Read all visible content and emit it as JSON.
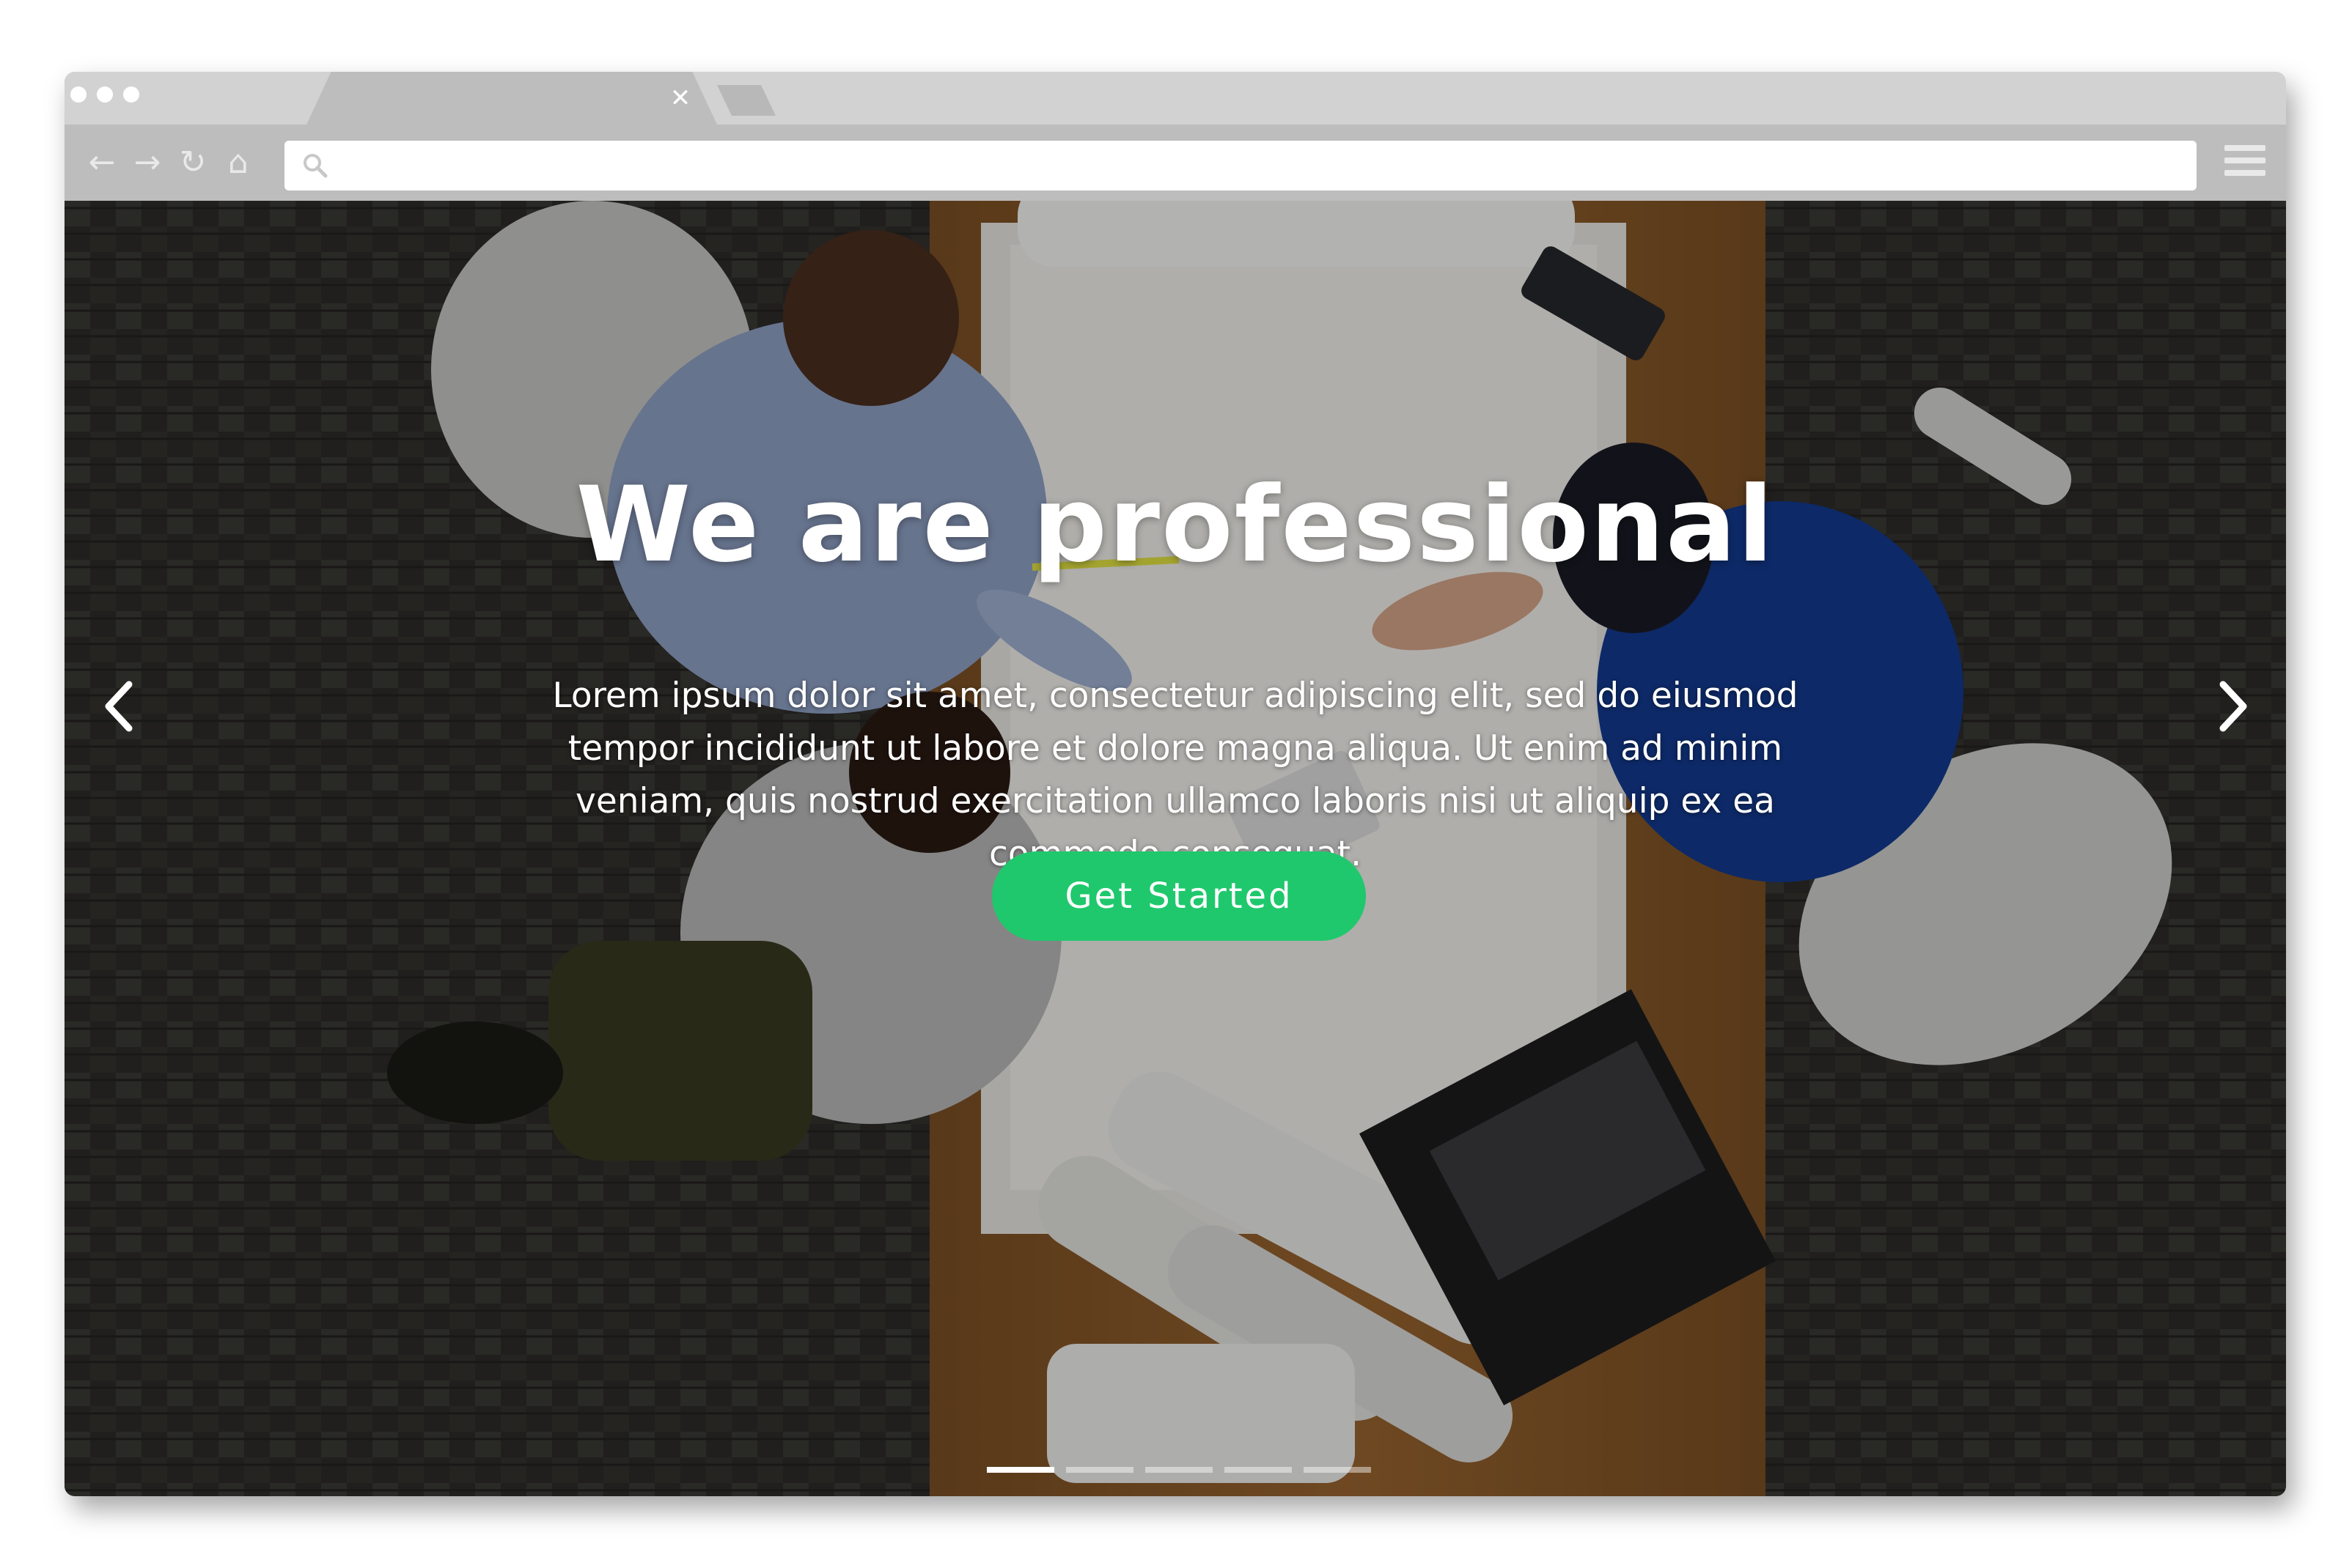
{
  "browser": {
    "tab": {
      "close_icon": "close-icon",
      "close_glyph": "✕"
    },
    "toolbar": {
      "back_icon": "arrow-left-icon",
      "forward_icon": "arrow-right-icon",
      "reload_icon": "reload-icon",
      "home_icon": "home-icon",
      "menu_icon": "hamburger-menu-icon",
      "search_icon": "search-icon",
      "back_glyph": "←",
      "forward_glyph": "→",
      "reload_glyph": "↻",
      "home_glyph": "⌂",
      "address_value": ""
    }
  },
  "hero": {
    "title": "We are professional",
    "paragraph": "Lorem ipsum dolor sit amet, consectetur adipiscing elit, sed do eiusmod tempor incididunt ut labore et dolore magna aliqua. Ut enim ad minim veniam, quis nostrud exercitation ullamco laboris nisi ut aliquip ex ea commodo consequat.",
    "cta_label": "Get Started",
    "prev_icon": "chevron-left-icon",
    "next_icon": "chevron-right-icon",
    "slide_count": 5,
    "active_slide": 1
  },
  "colors": {
    "accent": "#1fc86c",
    "chrome": "#bdbdbd",
    "text_on_image": "#ffffff"
  }
}
